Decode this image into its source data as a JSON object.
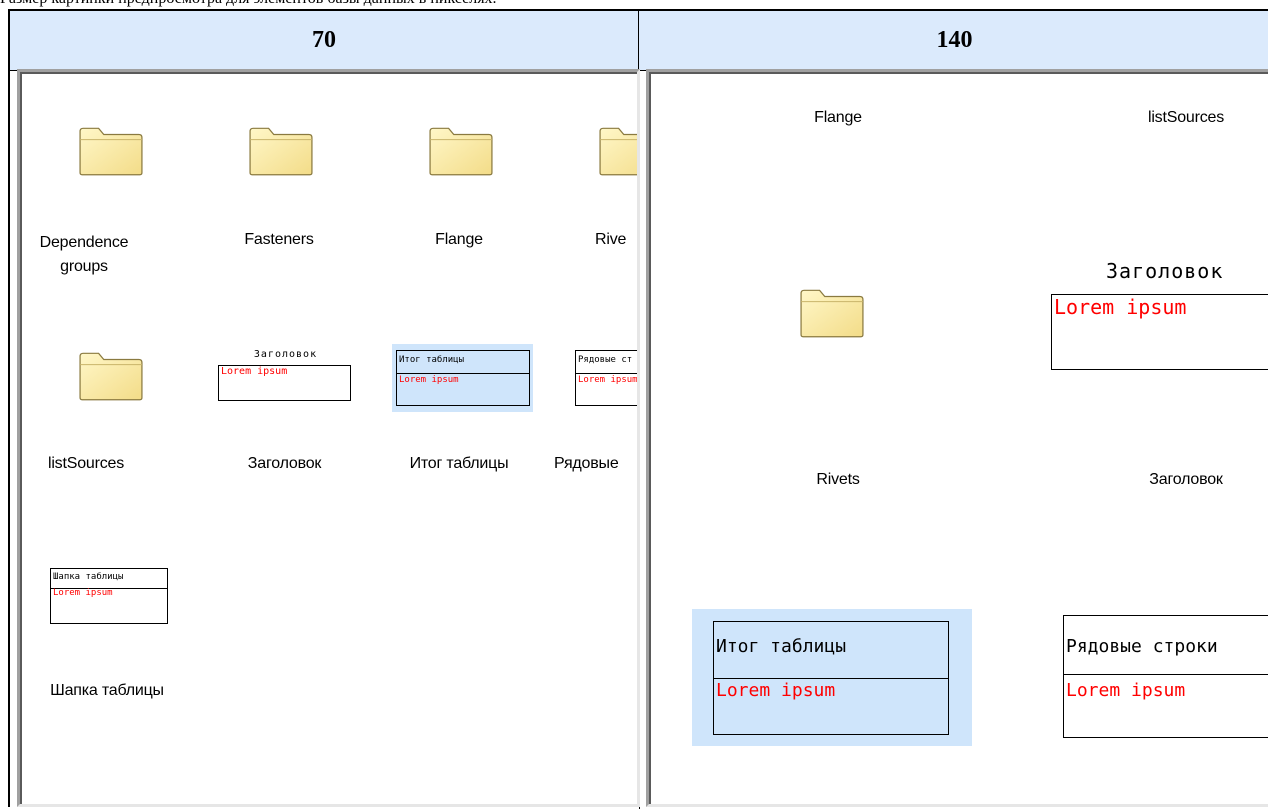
{
  "caption": "Размер картинки предпросмотра для элементов базы данных в пикселях.",
  "columns": [
    "70",
    "140"
  ],
  "panel70": {
    "row1": [
      "Dependence groups",
      "Fasteners",
      "Flange",
      "Rive"
    ],
    "row2": [
      "listSources",
      "Заголовок",
      "Итог таблицы",
      "Рядовые"
    ],
    "row3": [
      "Шапка таблицы"
    ],
    "thumb_titles": {
      "zagolovok": "Заголовок",
      "itog": "Итог таблицы",
      "ryadovye": "Рядовые ст",
      "shapka": "Шапка таблицы"
    },
    "lorem": "Lorem ipsum"
  },
  "panel140": {
    "top_labels": [
      "Flange",
      "listSources"
    ],
    "mid_labels": [
      "Rivets",
      "Заголовок"
    ],
    "thumb_titles": {
      "zagolovok": "Заголовок",
      "itog": "Итог таблицы",
      "ryadovye": "Рядовые строки"
    },
    "lorem": "Lorem ipsum"
  },
  "colors": {
    "header_bg": "#dbeafc",
    "selection": "#cfe5fb",
    "lorem": "#ff0000",
    "folder": "#fbeca6"
  }
}
